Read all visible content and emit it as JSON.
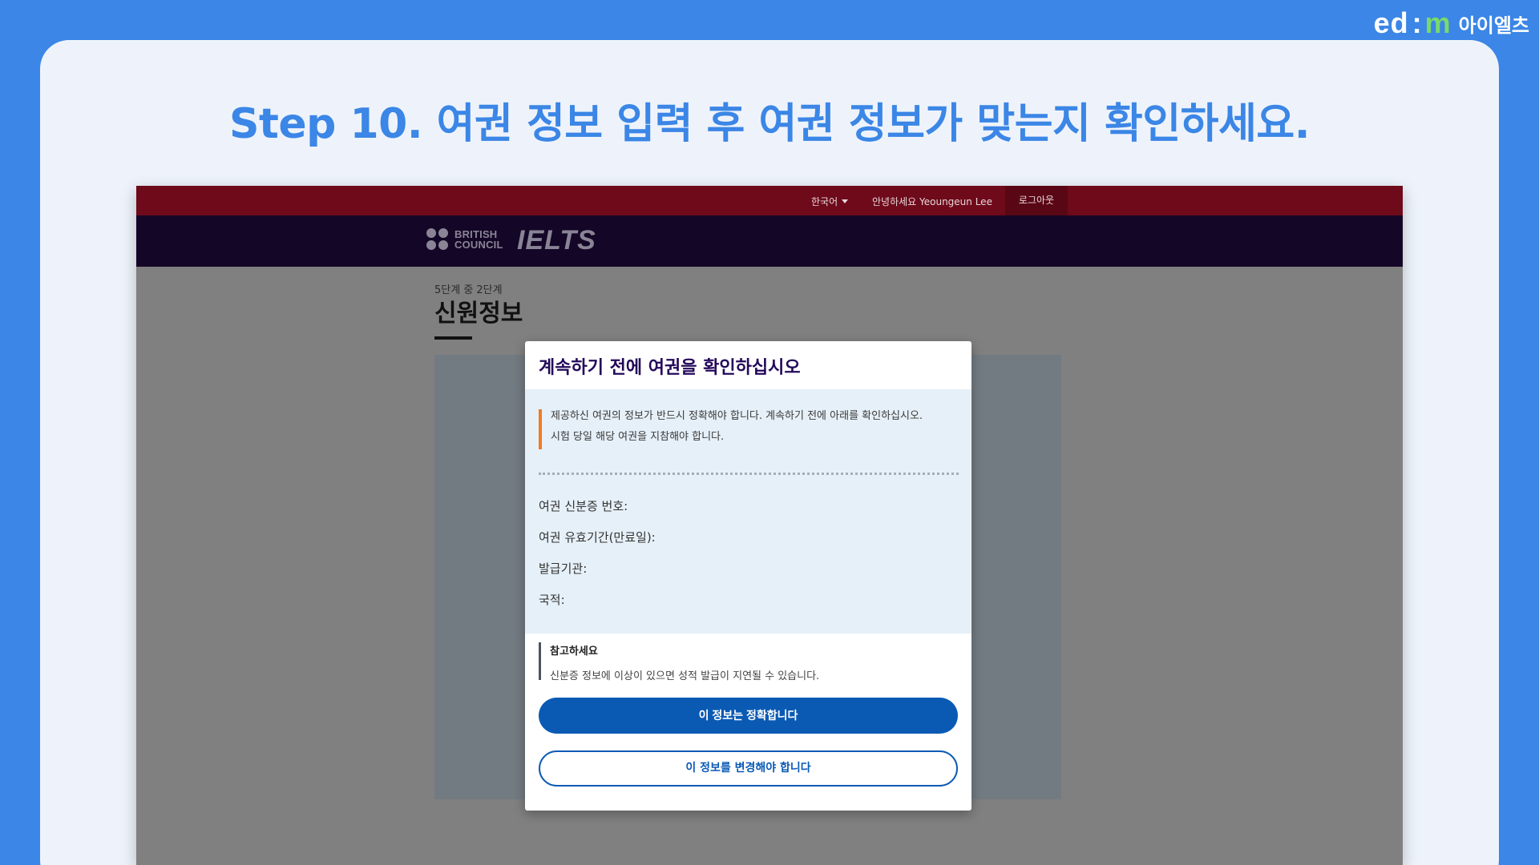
{
  "brand": {
    "logo_ed": "ed",
    "logo_colon": ":",
    "logo_m": "m",
    "text": "아이엘츠"
  },
  "step_title": "Step 10. 여권 정보 입력 후 여권 정보가 맞는지 확인하세요.",
  "browser": {
    "topbar": {
      "language": "한국어",
      "greeting": "안녕하세요 Yeoungeun Lee",
      "logout": "로그아웃"
    },
    "navbar": {
      "bc_line1": "BRITISH",
      "bc_line2": "COUNCIL",
      "ielts": "IELTS"
    },
    "page": {
      "stage": "5단계 중 2단계",
      "title": "신원정보"
    },
    "modal": {
      "title": "계속하기 전에 여권을 확인하십시오",
      "notice_line1": "제공하신 여권의 정보가 반드시 정확해야 합니다. 계속하기 전에 아래를 확인하십시오.",
      "notice_line2": "시험 당일 해당 여권을 지참해야 합니다.",
      "fields": {
        "passport_number": "여권 신분증 번호:",
        "expiry": "여권 유효기간(만료일):",
        "issuer": "발급기관:",
        "nationality": "국적:"
      },
      "note_title": "참고하세요",
      "note_text": "신분증 정보에 이상이 있으면 성적 발급이 지연될 수 있습니다.",
      "confirm_button": "이 정보는 정확합니다",
      "change_button": "이 정보를 변경해야 합니다"
    }
  },
  "colors": {
    "accent": "#3b86e6",
    "topbar": "#6e0a1a",
    "navbar": "#140627",
    "primary_button": "#0a5ab4",
    "notice_border": "#f07c22"
  }
}
